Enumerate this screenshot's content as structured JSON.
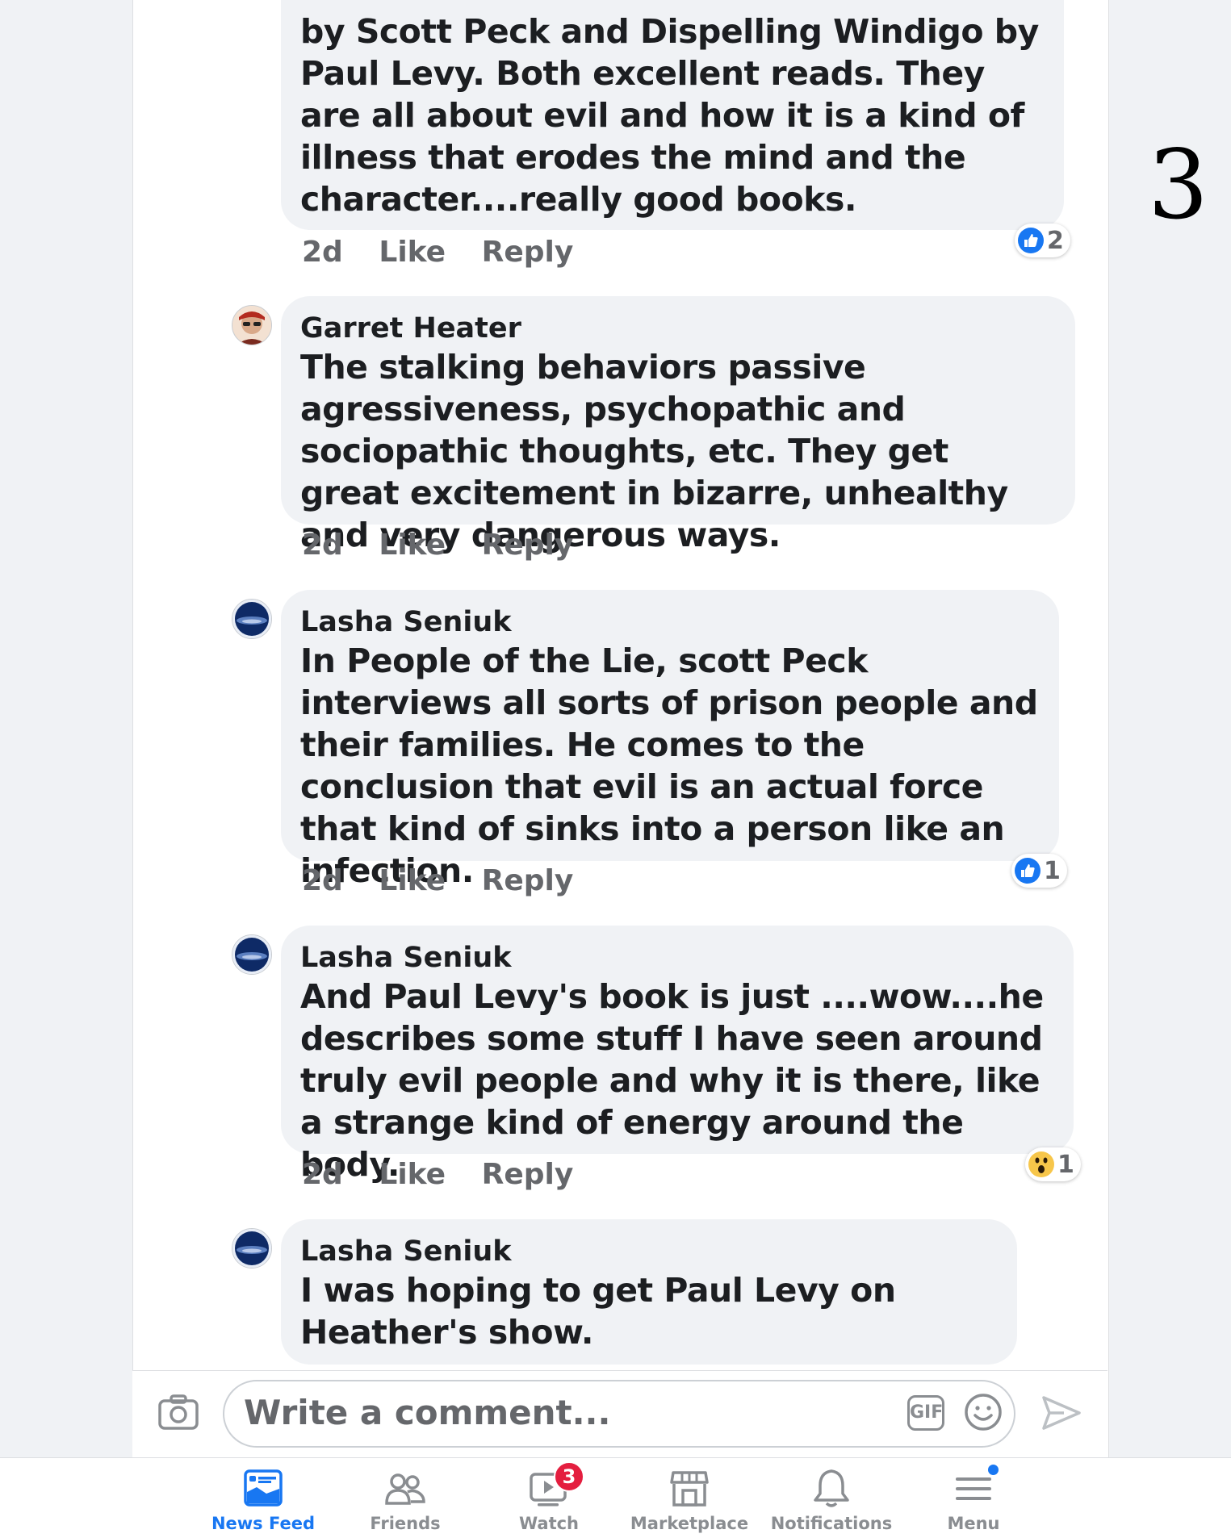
{
  "page_marker": "3",
  "comments": [
    {
      "text": "by Scott Peck and Dispelling Windigo by Paul Levy. Both excellent reads. They are all about evil and how it is a kind of illness that erodes the mind and the character....really good books.",
      "time": "2d",
      "like_label": "Like",
      "reply_label": "Reply",
      "reaction": {
        "type": "like",
        "count": "2"
      }
    },
    {
      "author": "Garret Heater",
      "text": "The stalking behaviors passive agressiveness, psychopathic and sociopathic thoughts, etc. They get great excitement in bizarre, unhealthy and very dangerous ways.",
      "time": "2d",
      "like_label": "Like",
      "reply_label": "Reply"
    },
    {
      "author": "Lasha Seniuk",
      "text": "In People of the Lie, scott Peck interviews all sorts of prison people and their families. He comes to the conclusion that evil is an actual force that kind of sinks into a person like an infection.",
      "time": "2d",
      "like_label": "Like",
      "reply_label": "Reply",
      "reaction": {
        "type": "like",
        "count": "1"
      }
    },
    {
      "author": "Lasha Seniuk",
      "text": "And Paul Levy's book is just ....wow....he describes some stuff I have seen around truly evil people and why it is there, like a strange kind of energy around the body.",
      "time": "2d",
      "like_label": "Like",
      "reply_label": "Reply",
      "reaction": {
        "type": "wow",
        "count": "1"
      }
    },
    {
      "author": "Lasha Seniuk",
      "text": "I was hoping to get Paul Levy on Heather's show."
    }
  ],
  "composer": {
    "placeholder": "Write a comment...",
    "gif_label": "GIF"
  },
  "tabs": [
    {
      "label": "News Feed",
      "icon": "news-feed-icon",
      "active": true
    },
    {
      "label": "Friends",
      "icon": "friends-icon"
    },
    {
      "label": "Watch",
      "icon": "watch-icon",
      "badge": "3"
    },
    {
      "label": "Marketplace",
      "icon": "marketplace-icon"
    },
    {
      "label": "Notifications",
      "icon": "bell-icon"
    },
    {
      "label": "Menu",
      "icon": "menu-icon"
    }
  ],
  "colors": {
    "accent": "#1877f2",
    "badge": "#e41e3f",
    "bubble": "#f0f2f5"
  }
}
